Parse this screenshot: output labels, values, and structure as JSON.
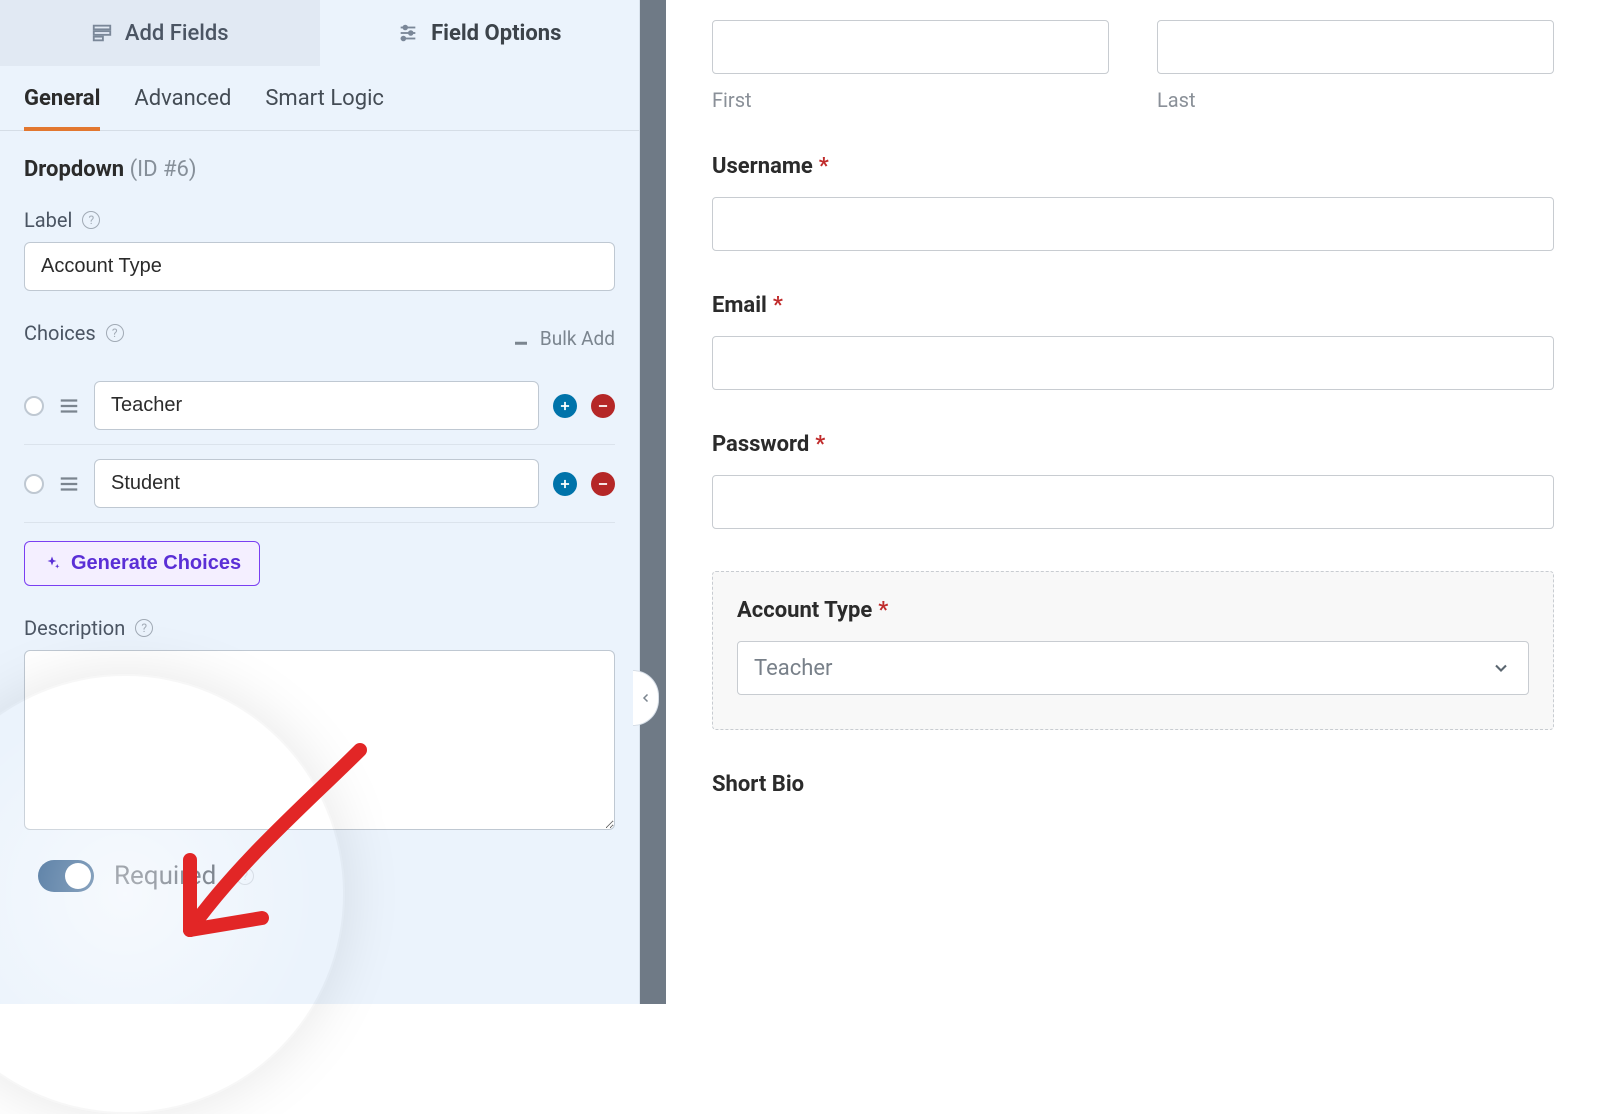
{
  "top_tabs": {
    "add_fields": "Add Fields",
    "field_options": "Field Options"
  },
  "sub_tabs": {
    "general": "General",
    "advanced": "Advanced",
    "smart_logic": "Smart Logic"
  },
  "field_header": {
    "type": "Dropdown",
    "id_text": "(ID #6)"
  },
  "label_section": {
    "label": "Label",
    "value": "Account Type"
  },
  "choices_section": {
    "label": "Choices",
    "bulk_add": "Bulk Add",
    "items": [
      "Teacher",
      "Student"
    ],
    "generate_button": "Generate Choices"
  },
  "description_section": {
    "label": "Description",
    "value": ""
  },
  "required_section": {
    "label": "Required",
    "enabled": true
  },
  "preview": {
    "name": {
      "first_label": "First",
      "last_label": "Last"
    },
    "username_label": "Username",
    "email_label": "Email",
    "password_label": "Password",
    "account_type": {
      "label": "Account Type",
      "value": "Teacher"
    },
    "short_bio_label": "Short Bio"
  }
}
